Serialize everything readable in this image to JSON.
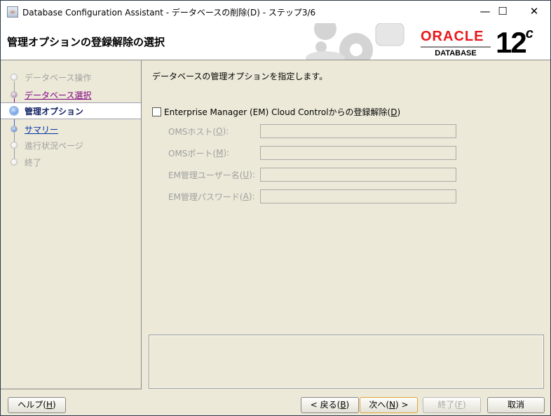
{
  "window": {
    "title": "Database Configuration Assistant - データベースの削除(D) - ステップ3/6"
  },
  "header": {
    "title": "管理オプションの登録解除の選択",
    "logo_brand": "ORACLE",
    "logo_product": "DATABASE",
    "logo_version": "12",
    "logo_version_suffix": "c"
  },
  "steps": [
    {
      "label": "データベース操作",
      "state": "done"
    },
    {
      "label": "データベース選択",
      "state": "visited"
    },
    {
      "label": "管理オプション",
      "state": "active"
    },
    {
      "label": "サマリー",
      "state": "link"
    },
    {
      "label": "進行状況ページ",
      "state": "disabled"
    },
    {
      "label": "終了",
      "state": "disabled"
    }
  ],
  "main": {
    "description": "データベースの管理オプションを指定します。",
    "checkbox": {
      "pre": "Enterprise Manager (EM) Cloud Controlからの登録解除(",
      "key": "D",
      "post": ")",
      "checked": false
    },
    "fields": [
      {
        "pre": "OMSホスト(",
        "key": "O",
        "post": "):",
        "value": ""
      },
      {
        "pre": "OMSポート(",
        "key": "M",
        "post": "):",
        "value": ""
      },
      {
        "pre": "EM管理ユーザー名(",
        "key": "U",
        "post": "):",
        "value": ""
      },
      {
        "pre": "EM管理パスワード(",
        "key": "A",
        "post": "):",
        "value": ""
      }
    ]
  },
  "buttons": {
    "help": {
      "pre": "ヘルプ(",
      "key": "H",
      "post": ")"
    },
    "back": {
      "pre": "< 戻る(",
      "key": "B",
      "post": ")"
    },
    "next": {
      "pre": "次へ(",
      "key": "N",
      "post": ") >"
    },
    "finish": {
      "pre": "終了(",
      "key": "F",
      "post": ")"
    },
    "cancel": {
      "label": "取消"
    }
  }
}
